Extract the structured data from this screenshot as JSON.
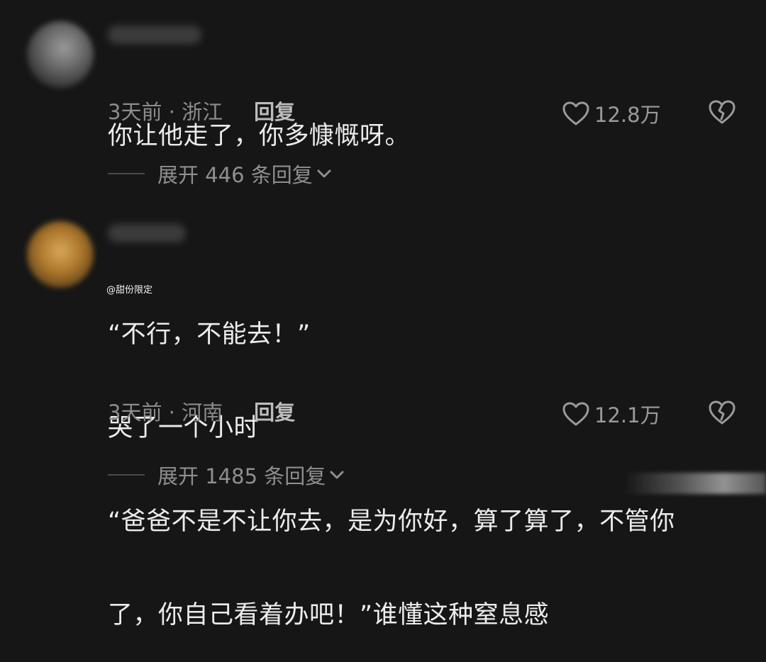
{
  "comments": [
    {
      "content_lines": [
        "你让他走了，你多慷慨呀。"
      ],
      "time_location": "3天前 · 浙江",
      "reply_label": "回复",
      "likes": "12.8万",
      "expand_label": "展开 446 条回复"
    },
    {
      "content_lines": [
        "“不行，不能去！”",
        "哭了一个小时",
        "“爸爸不是不让你去，是为你好，算了算了，不管你",
        "了，你自己看着办吧！”谁懂这种窒息感"
      ],
      "time_location": "3天前 · 河南",
      "reply_label": "回复",
      "likes": "12.1万",
      "expand_label": "展开 1485 条回复"
    }
  ],
  "watermark": "@甜份限定",
  "colors": {
    "background": "#161616",
    "text": "#ececec",
    "muted": "#8c8c8c"
  },
  "icons": [
    "heart-icon",
    "broken-heart-icon",
    "chevron-down-icon"
  ]
}
